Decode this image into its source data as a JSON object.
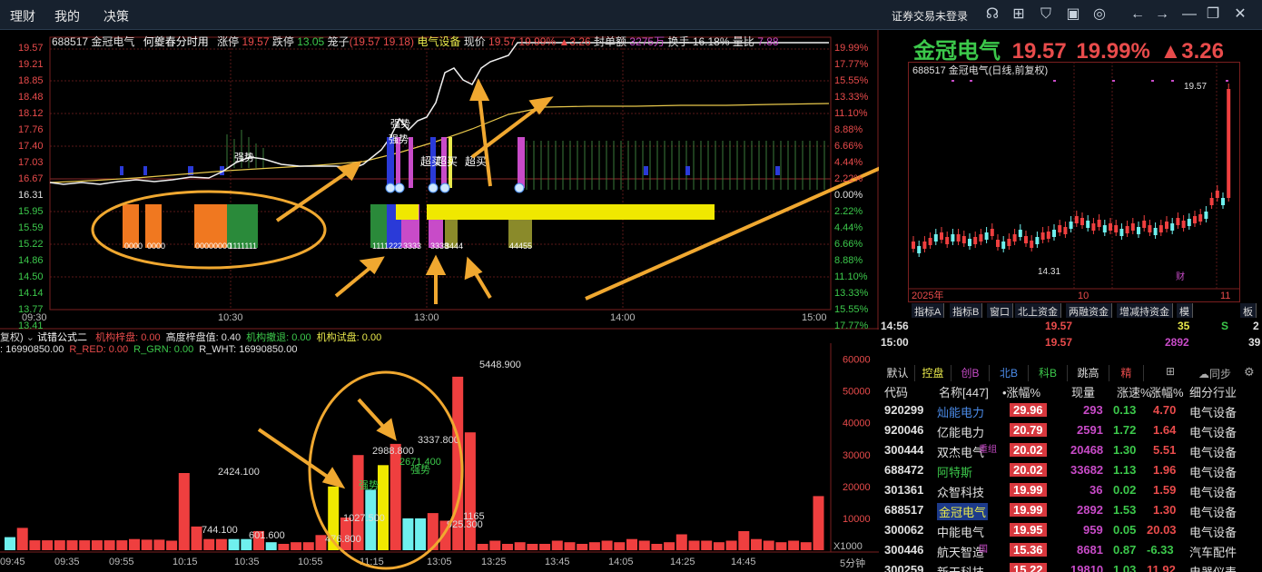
{
  "topbar": {
    "menu": [
      "理财",
      "我的",
      "决策"
    ],
    "login": "证券交易未登录",
    "icons": [
      "headset-icon",
      "grid-icon",
      "shirt-icon",
      "window-icon",
      "target-icon",
      "back-icon",
      "forward-icon",
      "minimize-icon",
      "restore-icon",
      "close-icon"
    ]
  },
  "infobar": {
    "code": "688517",
    "name": "金冠电气",
    "chart_title": "何夔春分时用",
    "limit_up_label": "涨停",
    "limit_up": "19.57",
    "limit_down_label": "跌停",
    "limit_down": "13.05",
    "cage_label": "笼子",
    "cage": "(19.57 19.18)",
    "sector": "电气设备",
    "price_label": "现价",
    "price": "19.57",
    "pct": "19.99%",
    "change": "▲3.26",
    "seal_label": "封单额",
    "seal": "3275万",
    "turnover_label": "换手",
    "turnover": "16.18%",
    "volratio_label": "量比",
    "volratio": "7.88"
  },
  "intraday_axis": {
    "left": [
      "19.57",
      "19.21",
      "18.85",
      "18.48",
      "18.12",
      "17.76",
      "17.40",
      "17.03",
      "16.67",
      "16.31",
      "15.95",
      "15.59",
      "15.22",
      "14.86",
      "14.50",
      "14.14",
      "13.77",
      "13.41"
    ],
    "right": [
      "19.99%",
      "17.77%",
      "15.55%",
      "13.33%",
      "11.10%",
      "8.88%",
      "6.66%",
      "4.44%",
      "2.22%",
      "0.00%",
      "2.22%",
      "4.44%",
      "6.66%",
      "8.88%",
      "11.10%",
      "13.33%",
      "15.55%",
      "17.77%"
    ],
    "time": [
      "09:30",
      "10:30",
      "13:00",
      "14:00",
      "15:00"
    ]
  },
  "intraday_labels": {
    "strong1": "强势",
    "strong2": "强势",
    "strong3": "强势",
    "super_buy1": "超买",
    "super_buy2": "超买",
    "super_buy3": "超买",
    "count_orange1": "0000",
    "count_orange2": "0000",
    "count_orange3": "00000000",
    "count_green1": "1111111",
    "count_mid1": "1111222",
    "count_mid2": "3333",
    "count_mid3": "3338",
    "count_mid4": "3444",
    "count_mid5": "44455"
  },
  "indicator": {
    "left_tag": "复权)",
    "formula": "试错公式二",
    "fields": [
      {
        "label": "机构梓盘: 0.00",
        "color": "#e84b4b"
      },
      {
        "label": "高度梓盘值: 0.40",
        "color": "#e0e0e0"
      },
      {
        "label": "机构撤退: 0.00",
        "color": "#3cc84b"
      },
      {
        "label": "机构试盘: 0.00",
        "color": "#e8e84b"
      }
    ],
    "line2": [
      {
        "label": ": 16990850.00",
        "color": "#e0e0e0"
      },
      {
        "label": "R_RED: 0.00",
        "color": "#e84b4b"
      },
      {
        "label": "R_GRN: 0.00",
        "color": "#3cc84b"
      },
      {
        "label": "R_WHT: 16990850.00",
        "color": "#e0e0e0"
      }
    ],
    "y_axis": [
      "60000",
      "50000",
      "40000",
      "30000",
      "20000",
      "10000"
    ],
    "unit": "X1000",
    "period": "5分钟",
    "time": [
      "09:45",
      "09:35",
      "09:55",
      "10:15",
      "10:35",
      "10:55",
      "11:15",
      "13:05",
      "13:25",
      "13:45",
      "14:05",
      "14:25",
      "14:45"
    ],
    "labels": [
      "5448.900",
      "3337.800",
      "2988.800",
      "2424.100",
      "1027.500",
      "2671.400",
      "1165",
      "925.300",
      "744.100",
      "601.600",
      "476.800"
    ],
    "tags": [
      "强势",
      "强势"
    ]
  },
  "chart_data": {
    "type": "bar",
    "title": "",
    "unit": "X1000",
    "ylim": [
      0,
      65000
    ],
    "values": [
      4100,
      7000,
      3100,
      3100,
      3100,
      3100,
      3100,
      3100,
      3100,
      3100,
      3500,
      3300,
      3300,
      3000,
      24241,
      7441,
      3500,
      3500,
      3500,
      3500,
      6016,
      2500,
      2000,
      2500,
      2500,
      4768,
      20000,
      10275,
      29888,
      19000,
      26714,
      33378,
      10000,
      10000,
      11650,
      9253,
      54489,
      37000,
      2000,
      3000,
      2000,
      2500,
      2000,
      2000,
      3000,
      2500,
      2000,
      2500,
      3000,
      2500,
      3500,
      3000,
      2000,
      2500,
      5000,
      3000,
      3000,
      2500,
      3000,
      6000,
      3500,
      3000,
      2500,
      3000,
      2500,
      17000
    ],
    "colors": [
      "cyan",
      "red",
      "red",
      "red",
      "red",
      "red",
      "red",
      "red",
      "red",
      "red",
      "red",
      "red",
      "red",
      "red",
      "red",
      "red",
      "red",
      "red",
      "cyan",
      "cyan",
      "red",
      "cyan",
      "red",
      "red",
      "red",
      "red",
      "yellow",
      "red",
      "red",
      "cyan",
      "yellow",
      "red",
      "cyan",
      "cyan",
      "red",
      "red",
      "red",
      "red",
      "red",
      "red",
      "red",
      "red",
      "red",
      "red",
      "red",
      "red",
      "red",
      "red",
      "red",
      "red",
      "red",
      "red",
      "red",
      "red",
      "red",
      "red",
      "red",
      "red",
      "red",
      "red",
      "red",
      "red",
      "red",
      "red",
      "red",
      "red"
    ]
  },
  "right": {
    "name": "金冠电气",
    "price": "19.57",
    "pct": "19.99%",
    "change": "▲3.26",
    "daily_title": "688517 金冠电气(日线,前复权)",
    "hi_label": "19.57",
    "lo_label": "14.31",
    "dates": [
      "2025年",
      "10",
      "11"
    ],
    "cai": "财",
    "tabs": [
      "指标A",
      "指标B",
      "窗口",
      "北上资金",
      "两融资金",
      "增减持资金",
      "模",
      "板"
    ],
    "trades": [
      {
        "time": "14:56",
        "price": "19.57",
        "vol": "35",
        "side": "S",
        "n": "2"
      },
      {
        "time": "15:00",
        "price": "19.57",
        "vol": "2892",
        "side": "",
        "n": "39"
      }
    ]
  },
  "list": {
    "tabs": [
      "默认",
      "控盘",
      "创B",
      "北B",
      "科B",
      "跳高",
      "精"
    ],
    "sync": "同步",
    "header": [
      "代码",
      "名称[447]",
      "•涨幅%",
      "现量",
      "涨速%",
      "涨幅%",
      "细分行业"
    ],
    "rows": [
      {
        "code": "920299",
        "name": "灿能电力",
        "pct": "29.96",
        "vol": "293",
        "speed": "0.13",
        "pct2": "4.70",
        "ind": "电气设备",
        "name_color": "#4b8be8"
      },
      {
        "code": "920046",
        "name": "亿能电力",
        "pct": "20.79",
        "vol": "2591",
        "speed": "1.72",
        "pct2": "1.64",
        "ind": "电气设备",
        "name_color": "#e0e0e0"
      },
      {
        "code": "300444",
        "name": "双杰电气",
        "pct": "20.02",
        "vol": "20468",
        "speed": "1.30",
        "pct2": "5.51",
        "ind": "电气设备",
        "name_color": "#e0e0e0",
        "tag": "重组"
      },
      {
        "code": "688472",
        "name": "阿特斯",
        "pct": "20.02",
        "vol": "33682",
        "speed": "1.13",
        "pct2": "1.96",
        "ind": "电气设备",
        "name_color": "#3cc84b"
      },
      {
        "code": "301361",
        "name": "众智科技",
        "pct": "19.99",
        "vol": "36",
        "speed": "0.02",
        "pct2": "1.59",
        "ind": "电气设备",
        "name_color": "#e0e0e0"
      },
      {
        "code": "688517",
        "name": "金冠电气",
        "pct": "19.99",
        "vol": "2892",
        "speed": "1.53",
        "pct2": "1.30",
        "ind": "电气设备",
        "name_color": "#e8e84b",
        "selected": true
      },
      {
        "code": "300062",
        "name": "中能电气",
        "pct": "19.95",
        "vol": "959",
        "speed": "0.05",
        "pct2": "20.03",
        "ind": "电气设备",
        "name_color": "#e0e0e0"
      },
      {
        "code": "300446",
        "name": "航天智造",
        "pct": "15.36",
        "vol": "8681",
        "speed": "0.87",
        "pct2": "-6.33",
        "ind": "汽车配件",
        "name_color": "#e0e0e0",
        "tag": "国"
      },
      {
        "code": "300259",
        "name": "新天科技",
        "pct": "15.22",
        "vol": "19810",
        "speed": "1.03",
        "pct2": "11.92",
        "ind": "电器仪表",
        "name_color": "#e0e0e0"
      }
    ]
  }
}
